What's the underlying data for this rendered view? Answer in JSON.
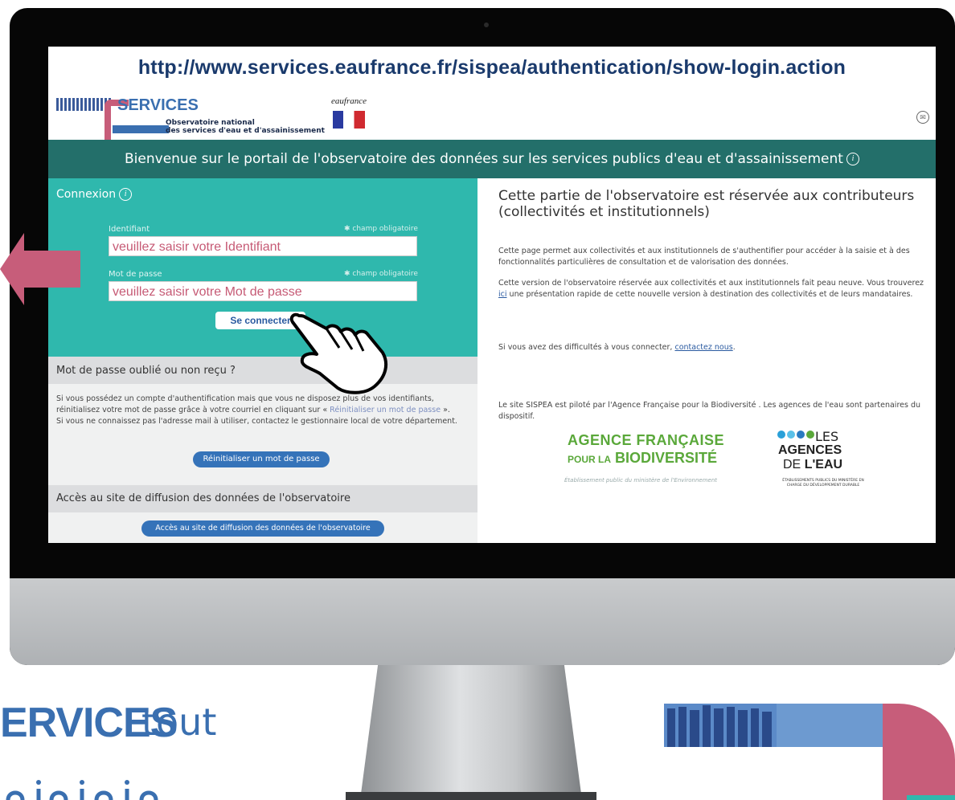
{
  "browser": {
    "url": "http://www.services.eaufrance.fr/sispea/authentication/show-login.action"
  },
  "header": {
    "logo_title": "SERVICES",
    "logo_subtitle_line1": "Observatoire national",
    "logo_subtitle_line2": "des services d'eau et d'assainissement",
    "partner_logo": "eaufrance"
  },
  "banner": {
    "text": "Bienvenue sur le portail de l'observatoire des données sur les services publics d'eau et d'assainissement"
  },
  "login": {
    "title": "Connexion",
    "identifiant_label": "Identifiant",
    "identifiant_required": "champ obligatoire",
    "identifiant_value": "veuillez saisir votre Identifiant",
    "password_label": "Mot de passe",
    "password_required": "champ obligatoire",
    "password_value": "veuillez saisir votre Mot de passe",
    "submit_label": "Se connecter"
  },
  "forgot": {
    "title": "Mot de passe oublié ou non reçu ?",
    "text_part1": "Si vous possédez un compte d'authentification mais que vous ne disposez plus de vos identifiants, réinitialisez votre mot de passe grâce à votre courriel en cliquant sur «",
    "text_link": "Réinitialiser un mot de passe",
    "text_part2": "». Si vous ne connaissez pas l'adresse mail à utiliser, contactez le gestionnaire local de votre département.",
    "button_label": "Réinitialiser un mot de passe"
  },
  "access": {
    "title": "Accès au site de diffusion des données de l'observatoire",
    "button_label": "Accès au site de diffusion des données de l'observatoire"
  },
  "right": {
    "title": "Cette partie de l'observatoire est réservée aux contributeurs (collectivités et institutionnels)",
    "para1": "Cette page permet aux collectivités et aux institutionnels de s'authentifier pour accéder à la saisie et à des fonctionnalités particulières de consultation et de valorisation des données.",
    "para2_part1": "Cette version de l'observatoire réservée aux collectivités et aux institutionnels fait peau neuve. Vous trouverez",
    "para2_link": "ici",
    "para2_part2": "une présentation rapide de cette nouvelle version à destination des collectivités et de leurs mandataires.",
    "para3_part1": "Si vous avez des difficultés à vous connecter,",
    "para3_link": "contactez nous",
    "para4": "Le site SISPEA est piloté par l'Agence Française pour la Biodiversité . Les agences de l'eau sont partenaires du dispositif."
  },
  "partners": {
    "afb_line1": "AGENCE FRANÇAISE",
    "afb_line2_small": "POUR LA",
    "afb_line2": "BIODIVERSITÉ",
    "afb_tagline": "Établissement public du ministère de l'Environnement",
    "agences_line1": "LES",
    "agences_line2": "AGENCES",
    "agences_line3_a": "DE",
    "agences_line3_b": "L'EAU",
    "agences_tagline": "ÉTABLISSEMENTS PUBLICS DU MINISTÈRE EN CHARGE DU DÉVELOPPEMENT DURABLE"
  },
  "poster": {
    "services_text": "ERVICES",
    "tout_text": "tout"
  },
  "colors": {
    "teal_banner": "#236f6a",
    "teal_panel": "#2fb8ad",
    "pink_accent": "#c75d7a",
    "blue_button": "#3573b9",
    "url_text": "#1a3a6c"
  }
}
